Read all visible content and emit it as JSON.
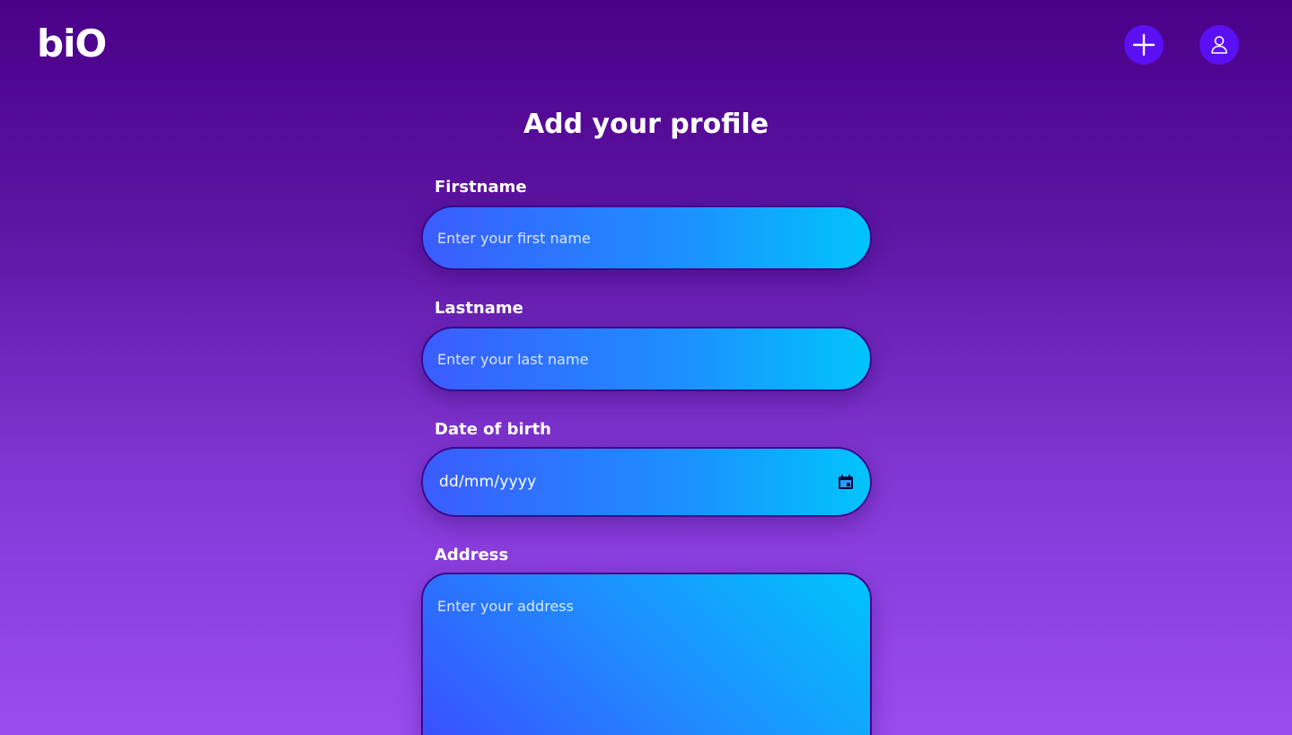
{
  "header": {
    "logo_text": "biO",
    "add_icon": "plus-icon",
    "profile_icon": "user-icon",
    "accent_color": "#5a10f2"
  },
  "page": {
    "title": "Add your profile"
  },
  "form": {
    "firstname": {
      "label": "Firstname",
      "placeholder": "Enter your first name",
      "value": ""
    },
    "lastname": {
      "label": "Lastname",
      "placeholder": "Enter your last name",
      "value": ""
    },
    "dob": {
      "label": "Date of birth",
      "display": "dd/mm/yyyy",
      "icon": "calendar-icon"
    },
    "address": {
      "label": "Address",
      "placeholder": "Enter your address",
      "value": ""
    }
  }
}
